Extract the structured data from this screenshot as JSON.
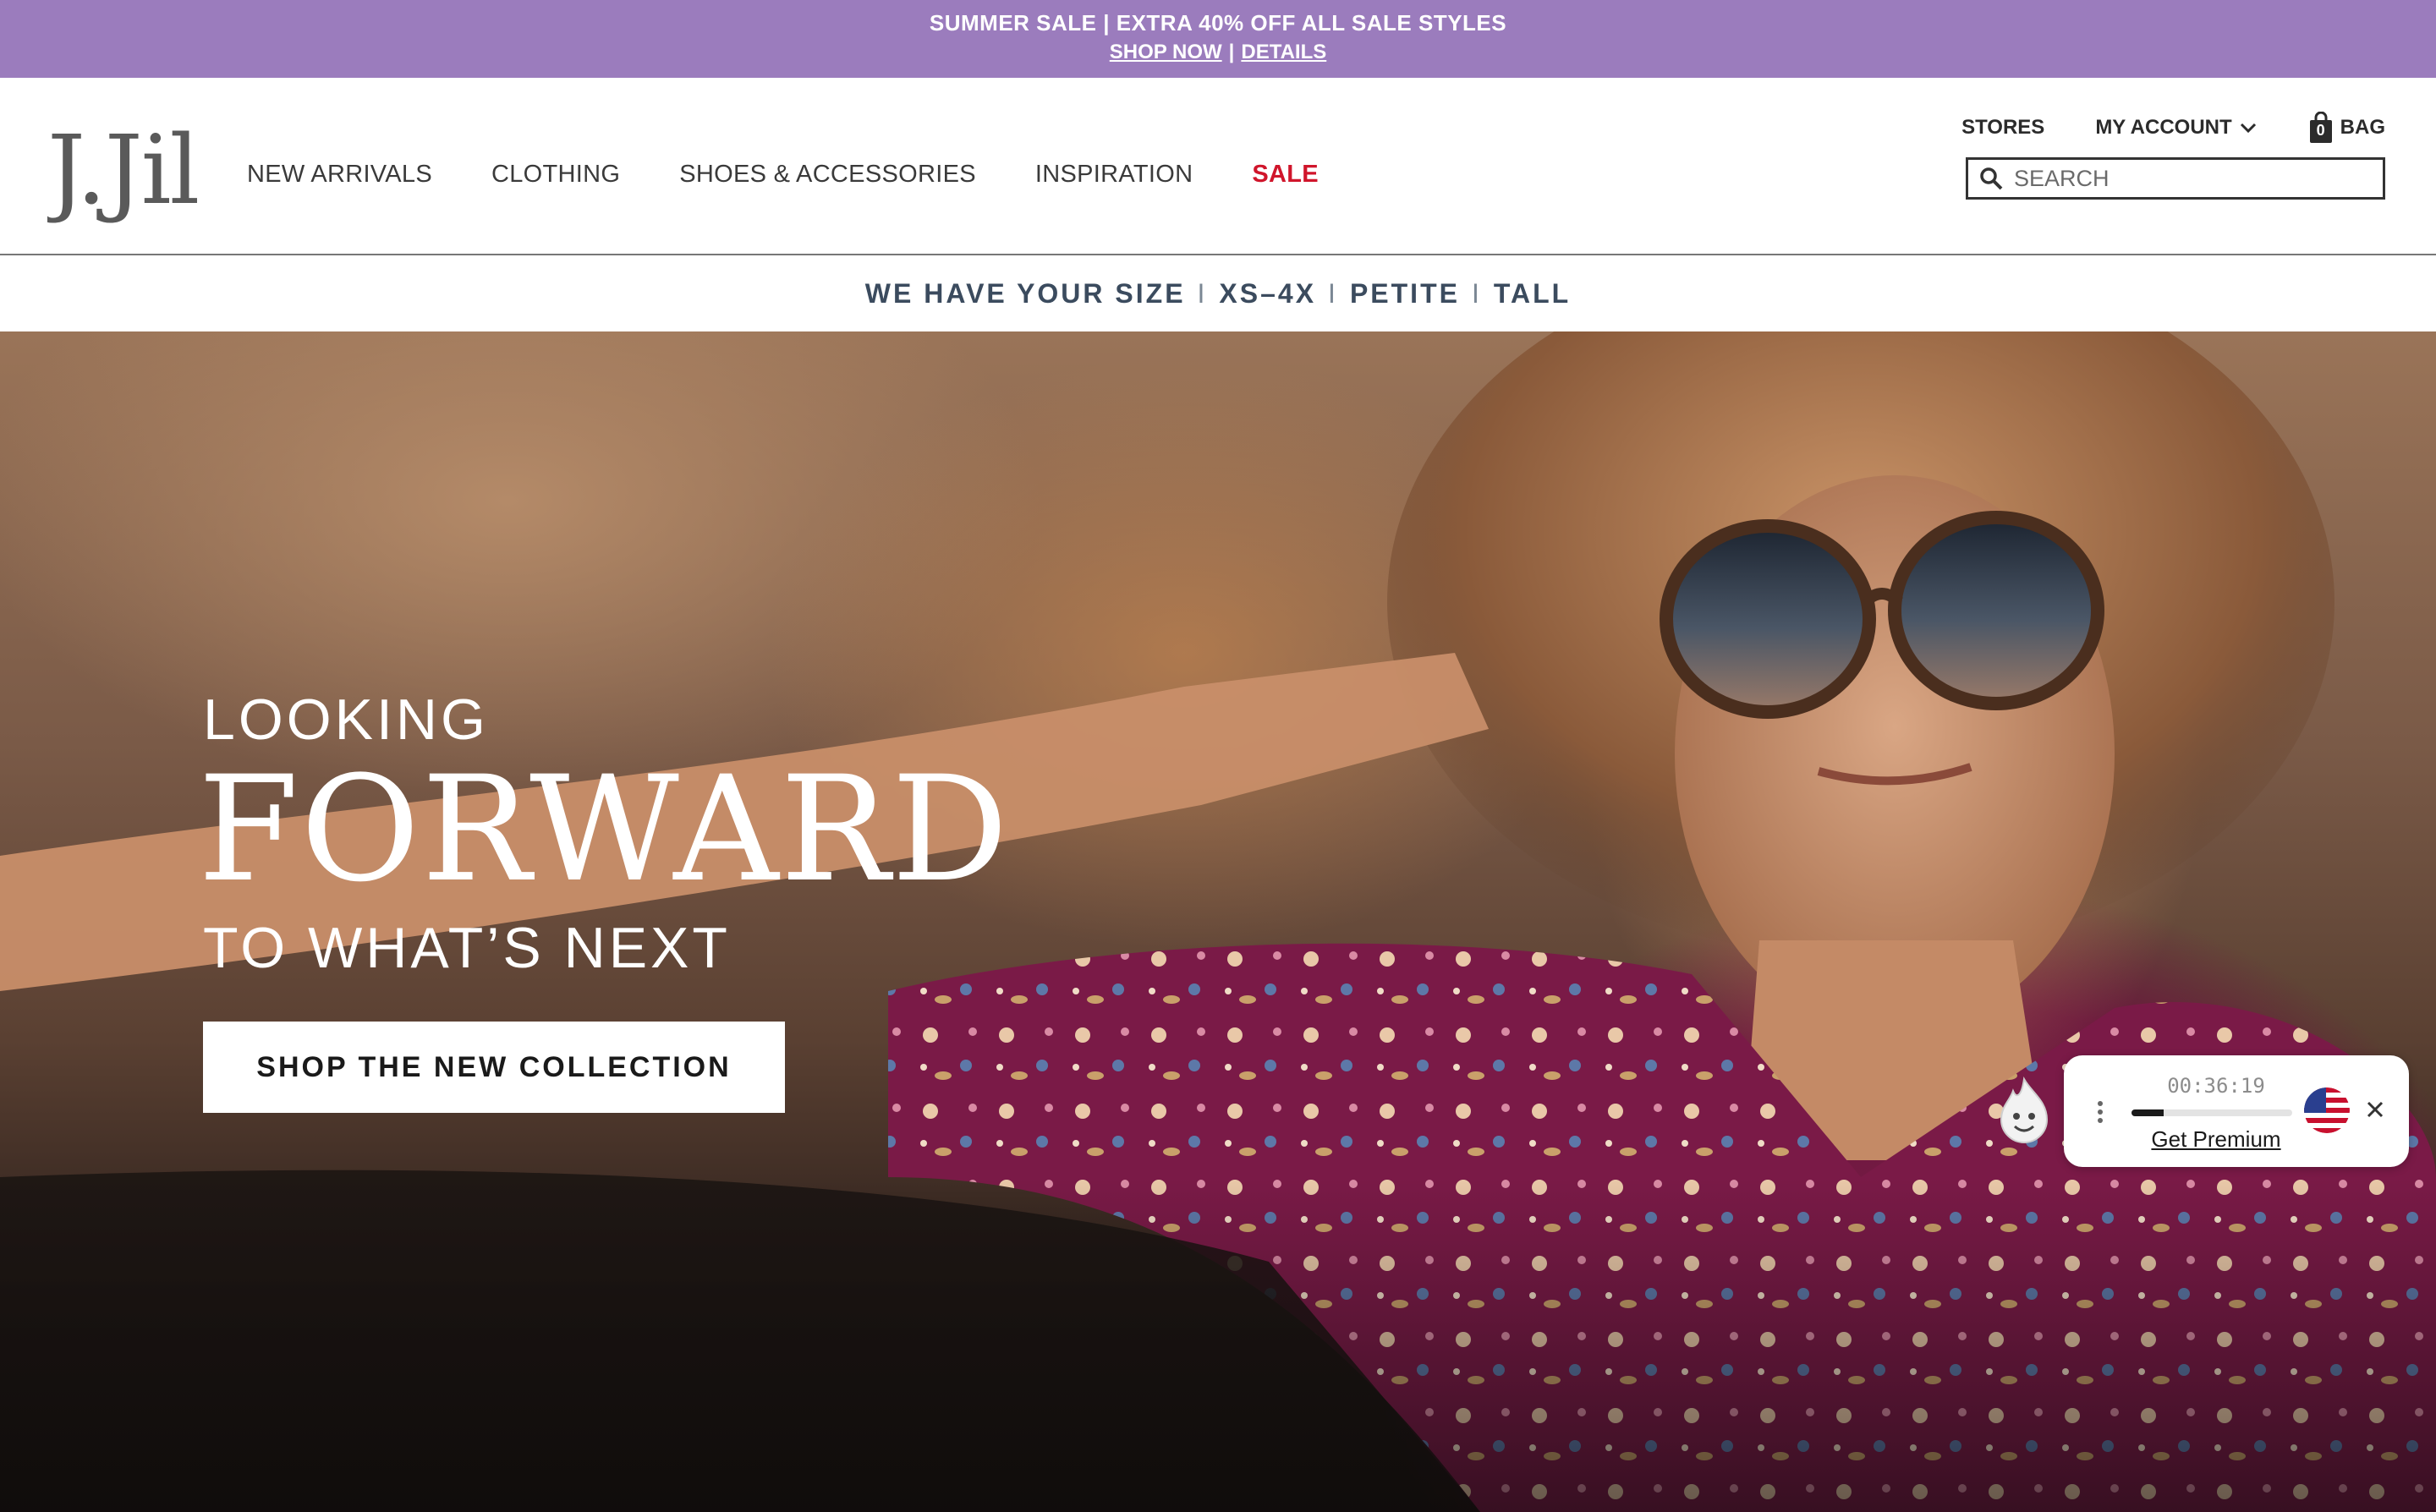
{
  "promo": {
    "title": "SUMMER SALE | EXTRA 40% OFF ALL SALE STYLES",
    "shop_now": "SHOP NOW",
    "separator": "|",
    "details": "DETAILS",
    "background": "#9b7cbd"
  },
  "header": {
    "logo_text": "J.Jill",
    "nav": [
      {
        "label": "NEW ARRIVALS"
      },
      {
        "label": "CLOTHING"
      },
      {
        "label": "SHOES & ACCESSORIES"
      },
      {
        "label": "INSPIRATION"
      },
      {
        "label": "SALE",
        "color": "#d0152b"
      }
    ],
    "utility": {
      "stores": "STORES",
      "my_account": "MY ACCOUNT",
      "bag": "BAG",
      "bag_count": "0"
    },
    "search": {
      "placeholder": "SEARCH",
      "icon": "search-icon"
    }
  },
  "size_strip": {
    "lead": "WE HAVE YOUR SIZE",
    "options": [
      "XS–4X",
      "PETITE",
      "TALL"
    ],
    "separator": "I",
    "color": "#3b4b5e"
  },
  "hero": {
    "line1": "LOOKING",
    "line2": "FORWARD",
    "line3": "TO WHAT’S NEXT",
    "cta": "SHOP THE NEW COLLECTION"
  },
  "timer_widget": {
    "time": "00:36:19",
    "progress": 0.2,
    "link": "Get Premium",
    "flag_icon": "us-flag-icon",
    "close_icon": "close-icon",
    "menu_icon": "more-vertical-icon"
  }
}
